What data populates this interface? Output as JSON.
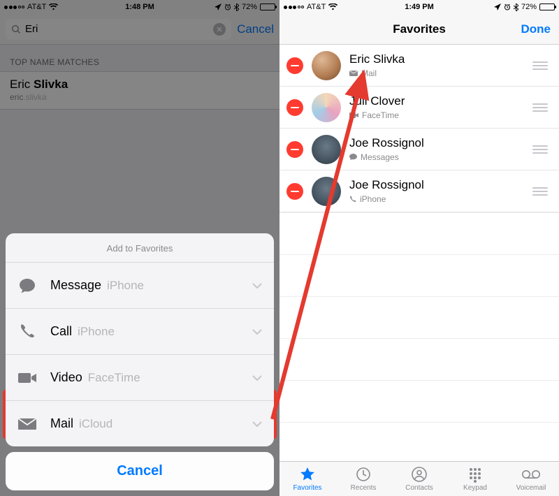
{
  "left": {
    "status": {
      "carrier": "AT&T",
      "time": "1:48 PM",
      "battery_pct": "72%"
    },
    "search": {
      "query": "Eri",
      "cancel": "Cancel"
    },
    "section_header": "TOP NAME MATCHES",
    "result": {
      "name_prefix": "Eric ",
      "name_bold": "Slivka",
      "sub_prefix": "eric",
      "sub_light": ".slivka"
    },
    "sheet": {
      "title": "Add to Favorites",
      "rows": [
        {
          "icon": "message",
          "primary": "Message",
          "secondary": "iPhone"
        },
        {
          "icon": "call",
          "primary": "Call",
          "secondary": "iPhone"
        },
        {
          "icon": "video",
          "primary": "Video",
          "secondary": "FaceTime"
        },
        {
          "icon": "mail",
          "primary": "Mail",
          "secondary": "iCloud"
        }
      ],
      "cancel": "Cancel"
    }
  },
  "right": {
    "status": {
      "carrier": "AT&T",
      "time": "1:49 PM",
      "battery_pct": "72%"
    },
    "header": {
      "title": "Favorites",
      "done": "Done"
    },
    "favorites": [
      {
        "name": "Eric Slivka",
        "method_icon": "mail",
        "method_label": "Mail"
      },
      {
        "name": "Juli Clover",
        "method_icon": "video",
        "method_label": "FaceTime"
      },
      {
        "name": "Joe Rossignol",
        "method_icon": "message",
        "method_label": "Messages"
      },
      {
        "name": "Joe Rossignol",
        "method_icon": "call",
        "method_label": "iPhone"
      }
    ],
    "tabs": [
      {
        "label": "Favorites",
        "icon": "star",
        "active": true
      },
      {
        "label": "Recents",
        "icon": "recents",
        "active": false
      },
      {
        "label": "Contacts",
        "icon": "contacts",
        "active": false
      },
      {
        "label": "Keypad",
        "icon": "keypad",
        "active": false
      },
      {
        "label": "Voicemail",
        "icon": "voicemail",
        "active": false
      }
    ]
  }
}
